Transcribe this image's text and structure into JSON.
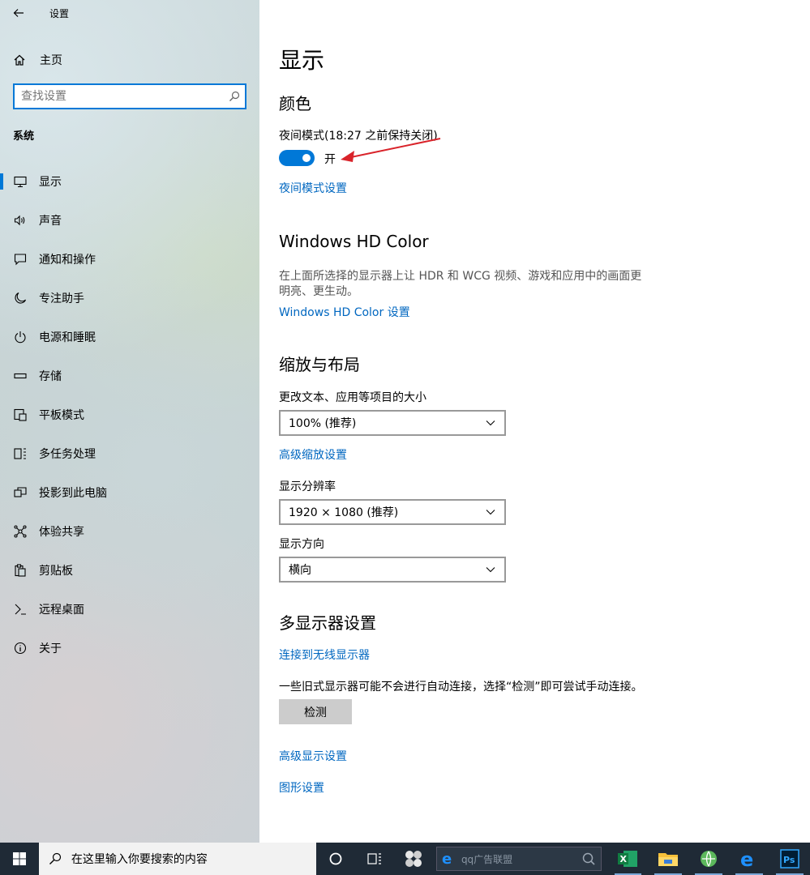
{
  "window": {
    "title": "设置"
  },
  "sidebar": {
    "home_label": "主页",
    "search_placeholder": "查找设置",
    "section_label": "系统",
    "items": [
      {
        "label": "显示",
        "icon": "monitor-icon",
        "active": true
      },
      {
        "label": "声音",
        "icon": "speaker-icon"
      },
      {
        "label": "通知和操作",
        "icon": "notification-icon"
      },
      {
        "label": "专注助手",
        "icon": "moon-icon"
      },
      {
        "label": "电源和睡眠",
        "icon": "power-icon"
      },
      {
        "label": "存储",
        "icon": "storage-icon"
      },
      {
        "label": "平板模式",
        "icon": "tablet-icon"
      },
      {
        "label": "多任务处理",
        "icon": "multitask-icon"
      },
      {
        "label": "投影到此电脑",
        "icon": "project-icon"
      },
      {
        "label": "体验共享",
        "icon": "share-icon"
      },
      {
        "label": "剪贴板",
        "icon": "clipboard-icon"
      },
      {
        "label": "远程桌面",
        "icon": "remote-icon"
      },
      {
        "label": "关于",
        "icon": "info-icon"
      }
    ]
  },
  "main": {
    "page_title": "显示",
    "color_section": {
      "heading": "颜色",
      "night_mode_label": "夜间模式(18:27 之前保持关闭)",
      "toggle_state": "开",
      "night_mode_settings_link": "夜间模式设置"
    },
    "hd_color_section": {
      "heading": "Windows HD Color",
      "description": "在上面所选择的显示器上让 HDR 和 WCG 视频、游戏和应用中的画面更明亮、更生动。",
      "settings_link": "Windows HD Color 设置"
    },
    "scale_section": {
      "heading": "缩放与布局",
      "scale_label": "更改文本、应用等项目的大小",
      "scale_value": "100% (推荐)",
      "advanced_scale_link": "高级缩放设置",
      "resolution_label": "显示分辨率",
      "resolution_value": "1920 × 1080 (推荐)",
      "orientation_label": "显示方向",
      "orientation_value": "横向"
    },
    "multi_display_section": {
      "heading": "多显示器设置",
      "wireless_link": "连接到无线显示器",
      "detect_text": "一些旧式显示器可能不会进行自动连接，选择“检测”即可尝试手动连接。",
      "detect_button": "检测",
      "advanced_display_link": "高级显示设置",
      "graphics_link": "图形设置"
    }
  },
  "taskbar": {
    "search_placeholder": "在这里输入你要搜索的内容",
    "qq_placeholder": "qq广告联盟",
    "colors": {
      "background": "#1f2a36",
      "accent": "#0078d7"
    }
  }
}
